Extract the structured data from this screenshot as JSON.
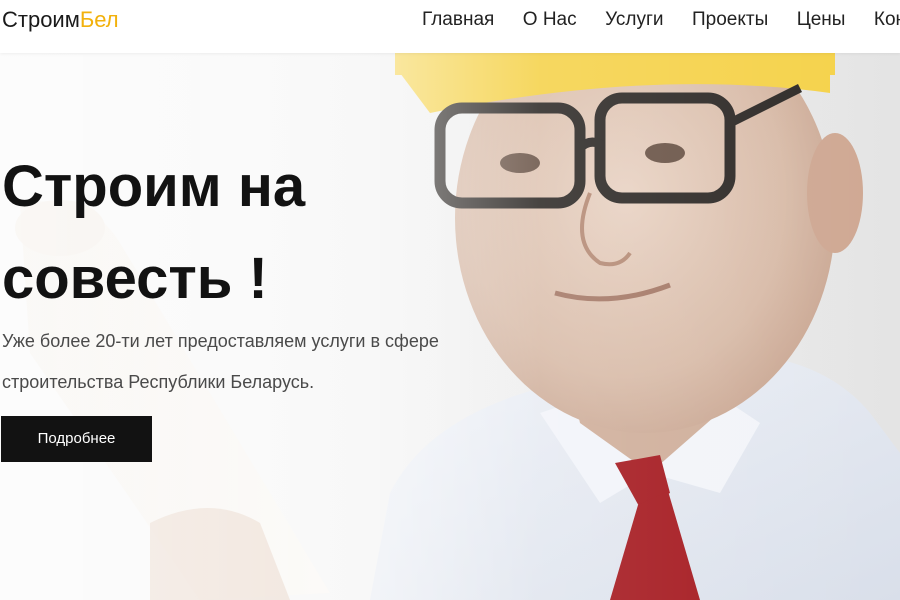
{
  "header": {
    "logo": {
      "main": "Строим",
      "accent": "Бел"
    },
    "nav": [
      "Главная",
      "О Нас",
      "Услуги",
      "Проекты",
      "Цены",
      "Контакты"
    ]
  },
  "hero": {
    "headline_line1": "Строим на",
    "headline_line2": "совесть !",
    "subtitle_line1": "Уже более 20-ти лет предоставляем услуги в сфере",
    "subtitle_line2": "строительства Республики Беларусь.",
    "button_label": "Подробнее",
    "background_image": "elderly-engineer-in-hard-hat-photo"
  },
  "colors": {
    "accent": "#f2b10c",
    "button_bg": "#121212",
    "tie": "#a5191f",
    "hard_hat": "#f5d24a"
  }
}
